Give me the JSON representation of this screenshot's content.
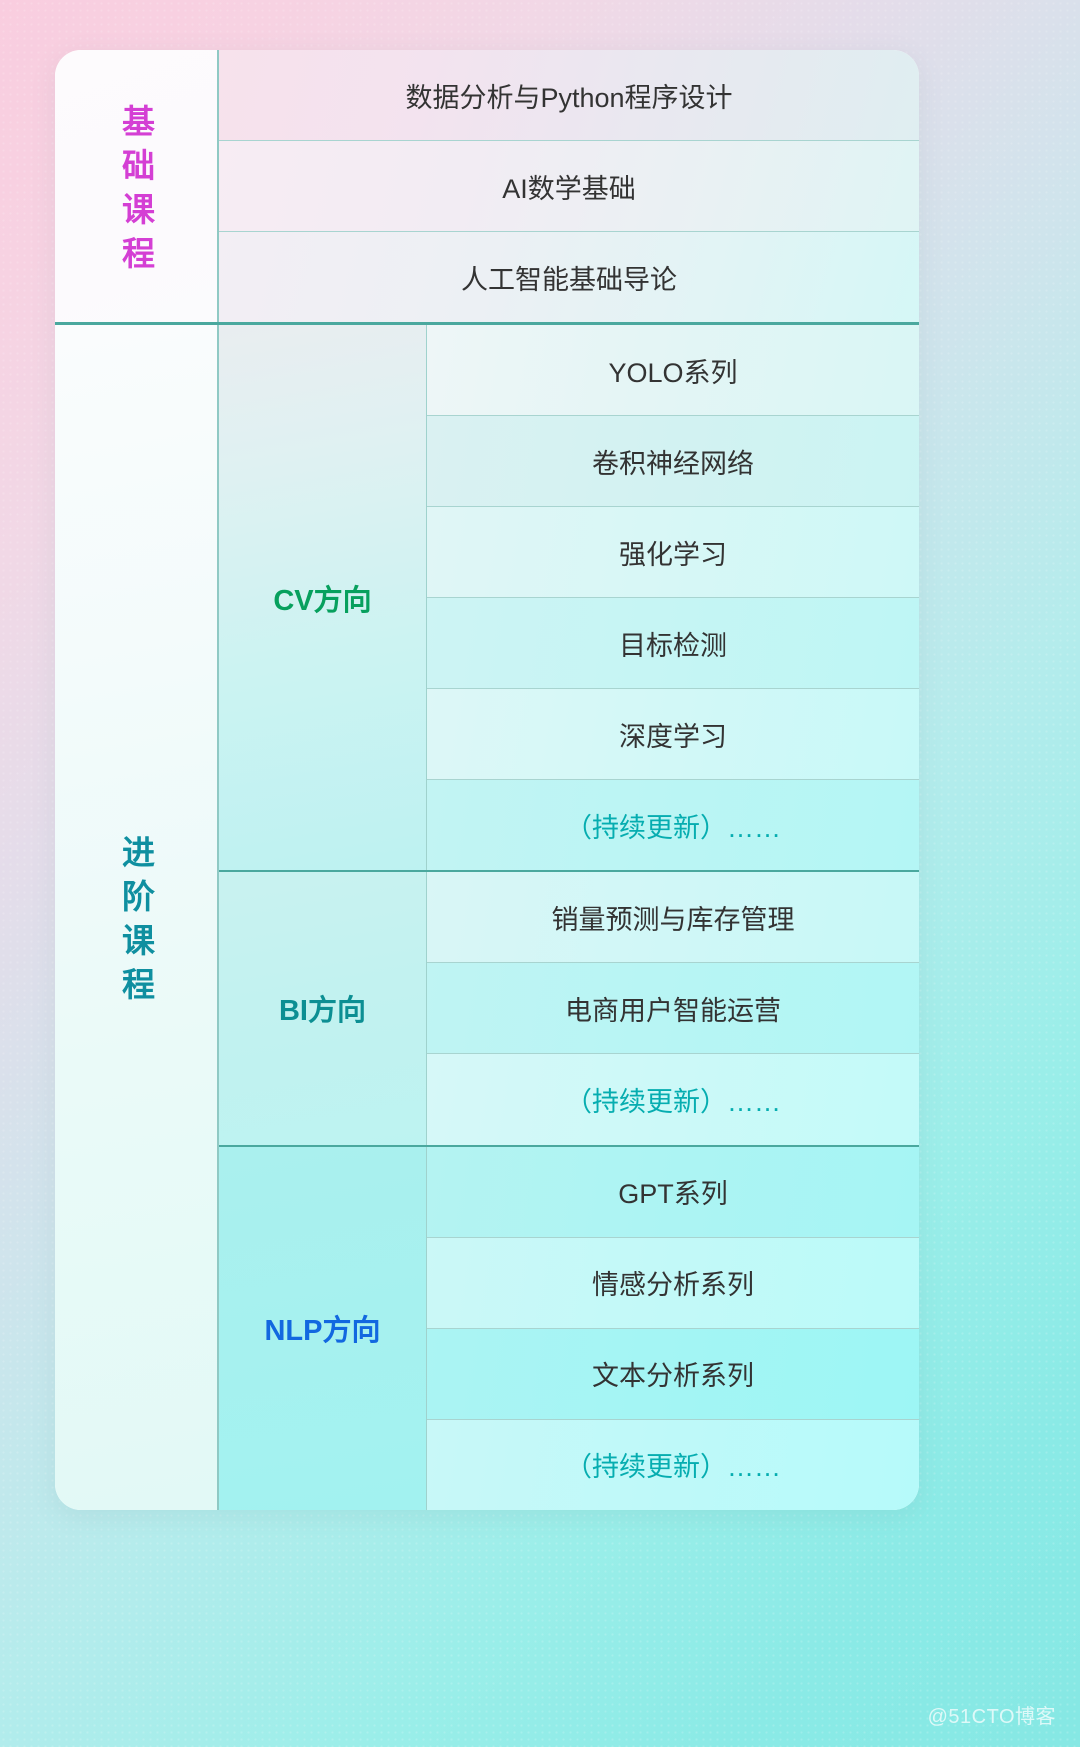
{
  "watermark": "@51CTO博客",
  "colors": {
    "basic_label": "#d43fd4",
    "advanced_label": "#0f8fa0",
    "cv_label": "#07a05e",
    "bi_label": "#0c8f93",
    "nlp_label": "#1268e0",
    "update_text": "#06adb0",
    "divider_strong": "#4aa89e",
    "divider_light": "#a8d4d0"
  },
  "sections": [
    {
      "label": "基础课程",
      "courses": [
        "数据分析与Python程序设计",
        "AI数学基础",
        "人工智能基础导论"
      ]
    },
    {
      "label": "进阶课程",
      "directions": [
        {
          "name": "CV方向",
          "courses": [
            "YOLO系列",
            "卷积神经网络",
            "强化学习",
            "目标检测",
            "深度学习",
            "（持续更新）……"
          ]
        },
        {
          "name": "BI方向",
          "courses": [
            "销量预测与库存管理",
            "电商用户智能运营",
            "（持续更新）……"
          ]
        },
        {
          "name": "NLP方向",
          "courses": [
            "GPT系列",
            "情感分析系列",
            "文本分析系列",
            "（持续更新）……"
          ]
        }
      ]
    }
  ]
}
